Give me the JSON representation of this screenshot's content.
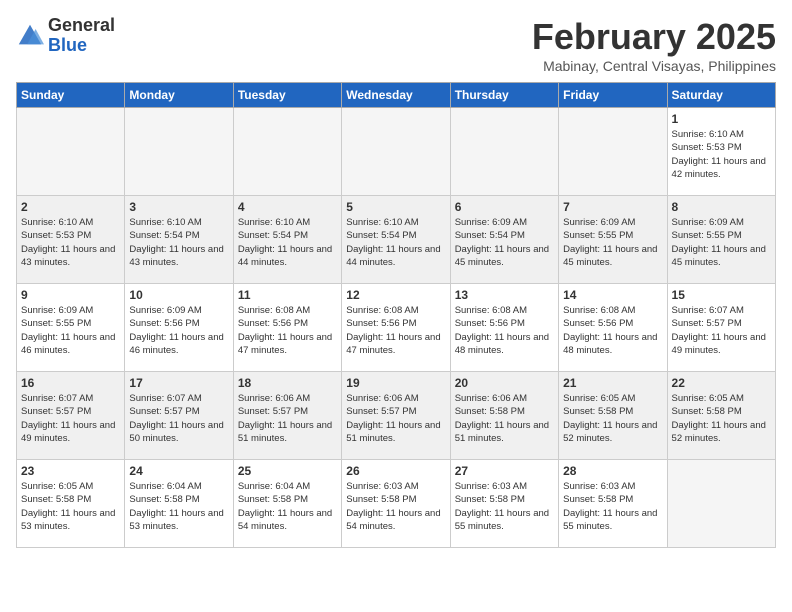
{
  "header": {
    "logo_general": "General",
    "logo_blue": "Blue",
    "title": "February 2025",
    "subtitle": "Mabinay, Central Visayas, Philippines"
  },
  "columns": [
    "Sunday",
    "Monday",
    "Tuesday",
    "Wednesday",
    "Thursday",
    "Friday",
    "Saturday"
  ],
  "weeks": [
    {
      "shaded": false,
      "days": [
        {
          "num": "",
          "detail": ""
        },
        {
          "num": "",
          "detail": ""
        },
        {
          "num": "",
          "detail": ""
        },
        {
          "num": "",
          "detail": ""
        },
        {
          "num": "",
          "detail": ""
        },
        {
          "num": "",
          "detail": ""
        },
        {
          "num": "1",
          "detail": "Sunrise: 6:10 AM\nSunset: 5:53 PM\nDaylight: 11 hours\nand 42 minutes."
        }
      ]
    },
    {
      "shaded": true,
      "days": [
        {
          "num": "2",
          "detail": "Sunrise: 6:10 AM\nSunset: 5:53 PM\nDaylight: 11 hours\nand 43 minutes."
        },
        {
          "num": "3",
          "detail": "Sunrise: 6:10 AM\nSunset: 5:54 PM\nDaylight: 11 hours\nand 43 minutes."
        },
        {
          "num": "4",
          "detail": "Sunrise: 6:10 AM\nSunset: 5:54 PM\nDaylight: 11 hours\nand 44 minutes."
        },
        {
          "num": "5",
          "detail": "Sunrise: 6:10 AM\nSunset: 5:54 PM\nDaylight: 11 hours\nand 44 minutes."
        },
        {
          "num": "6",
          "detail": "Sunrise: 6:09 AM\nSunset: 5:54 PM\nDaylight: 11 hours\nand 45 minutes."
        },
        {
          "num": "7",
          "detail": "Sunrise: 6:09 AM\nSunset: 5:55 PM\nDaylight: 11 hours\nand 45 minutes."
        },
        {
          "num": "8",
          "detail": "Sunrise: 6:09 AM\nSunset: 5:55 PM\nDaylight: 11 hours\nand 45 minutes."
        }
      ]
    },
    {
      "shaded": false,
      "days": [
        {
          "num": "9",
          "detail": "Sunrise: 6:09 AM\nSunset: 5:55 PM\nDaylight: 11 hours\nand 46 minutes."
        },
        {
          "num": "10",
          "detail": "Sunrise: 6:09 AM\nSunset: 5:56 PM\nDaylight: 11 hours\nand 46 minutes."
        },
        {
          "num": "11",
          "detail": "Sunrise: 6:08 AM\nSunset: 5:56 PM\nDaylight: 11 hours\nand 47 minutes."
        },
        {
          "num": "12",
          "detail": "Sunrise: 6:08 AM\nSunset: 5:56 PM\nDaylight: 11 hours\nand 47 minutes."
        },
        {
          "num": "13",
          "detail": "Sunrise: 6:08 AM\nSunset: 5:56 PM\nDaylight: 11 hours\nand 48 minutes."
        },
        {
          "num": "14",
          "detail": "Sunrise: 6:08 AM\nSunset: 5:56 PM\nDaylight: 11 hours\nand 48 minutes."
        },
        {
          "num": "15",
          "detail": "Sunrise: 6:07 AM\nSunset: 5:57 PM\nDaylight: 11 hours\nand 49 minutes."
        }
      ]
    },
    {
      "shaded": true,
      "days": [
        {
          "num": "16",
          "detail": "Sunrise: 6:07 AM\nSunset: 5:57 PM\nDaylight: 11 hours\nand 49 minutes."
        },
        {
          "num": "17",
          "detail": "Sunrise: 6:07 AM\nSunset: 5:57 PM\nDaylight: 11 hours\nand 50 minutes."
        },
        {
          "num": "18",
          "detail": "Sunrise: 6:06 AM\nSunset: 5:57 PM\nDaylight: 11 hours\nand 51 minutes."
        },
        {
          "num": "19",
          "detail": "Sunrise: 6:06 AM\nSunset: 5:57 PM\nDaylight: 11 hours\nand 51 minutes."
        },
        {
          "num": "20",
          "detail": "Sunrise: 6:06 AM\nSunset: 5:58 PM\nDaylight: 11 hours\nand 51 minutes."
        },
        {
          "num": "21",
          "detail": "Sunrise: 6:05 AM\nSunset: 5:58 PM\nDaylight: 11 hours\nand 52 minutes."
        },
        {
          "num": "22",
          "detail": "Sunrise: 6:05 AM\nSunset: 5:58 PM\nDaylight: 11 hours\nand 52 minutes."
        }
      ]
    },
    {
      "shaded": false,
      "days": [
        {
          "num": "23",
          "detail": "Sunrise: 6:05 AM\nSunset: 5:58 PM\nDaylight: 11 hours\nand 53 minutes."
        },
        {
          "num": "24",
          "detail": "Sunrise: 6:04 AM\nSunset: 5:58 PM\nDaylight: 11 hours\nand 53 minutes."
        },
        {
          "num": "25",
          "detail": "Sunrise: 6:04 AM\nSunset: 5:58 PM\nDaylight: 11 hours\nand 54 minutes."
        },
        {
          "num": "26",
          "detail": "Sunrise: 6:03 AM\nSunset: 5:58 PM\nDaylight: 11 hours\nand 54 minutes."
        },
        {
          "num": "27",
          "detail": "Sunrise: 6:03 AM\nSunset: 5:58 PM\nDaylight: 11 hours\nand 55 minutes."
        },
        {
          "num": "28",
          "detail": "Sunrise: 6:03 AM\nSunset: 5:58 PM\nDaylight: 11 hours\nand 55 minutes."
        },
        {
          "num": "",
          "detail": ""
        }
      ]
    }
  ]
}
